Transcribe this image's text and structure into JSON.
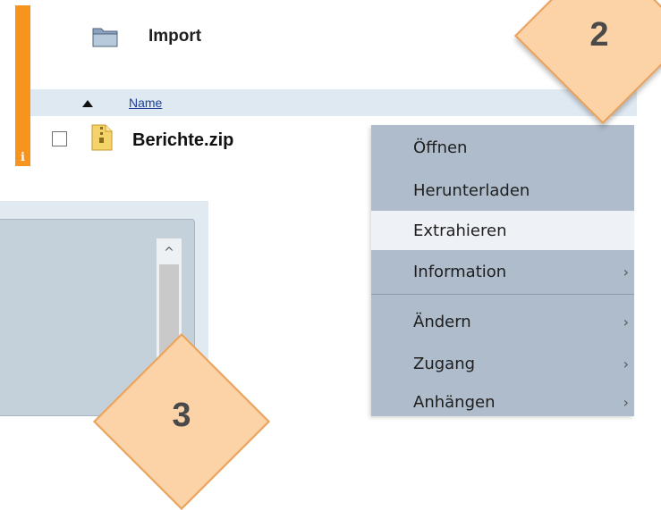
{
  "header": {
    "folder_icon": "folder-icon",
    "title": "Import",
    "info_badge": "i"
  },
  "table": {
    "columns": [
      {
        "label": "Name",
        "sort": "ascending"
      }
    ],
    "rows": [
      {
        "name": "Berichte.zip",
        "icon": "zip-file-icon",
        "checked": false
      }
    ]
  },
  "context_menu": {
    "items": [
      {
        "label": "Öffnen",
        "submenu": false,
        "highlighted": false
      },
      {
        "label": "Herunterladen",
        "submenu": false,
        "highlighted": false
      },
      {
        "label": "Extrahieren",
        "submenu": false,
        "highlighted": true
      },
      {
        "label": "Information",
        "submenu": true,
        "highlighted": false
      },
      {
        "label": "Ändern",
        "submenu": true,
        "highlighted": false
      },
      {
        "label": "Zugang",
        "submenu": true,
        "highlighted": false
      },
      {
        "label": "Anhängen",
        "submenu": true,
        "highlighted": false
      }
    ],
    "submenu_glyph": "›"
  },
  "callouts": [
    {
      "label": "2"
    },
    {
      "label": "3"
    }
  ],
  "scrollbar": {
    "up_glyph": "^"
  },
  "colors": {
    "accent_orange": "#f7941d",
    "callout_fill": "#fbd3a6",
    "menu_bg": "#afbccb",
    "menu_highlight": "#eef1f5",
    "link_blue": "#1c3f9c"
  }
}
